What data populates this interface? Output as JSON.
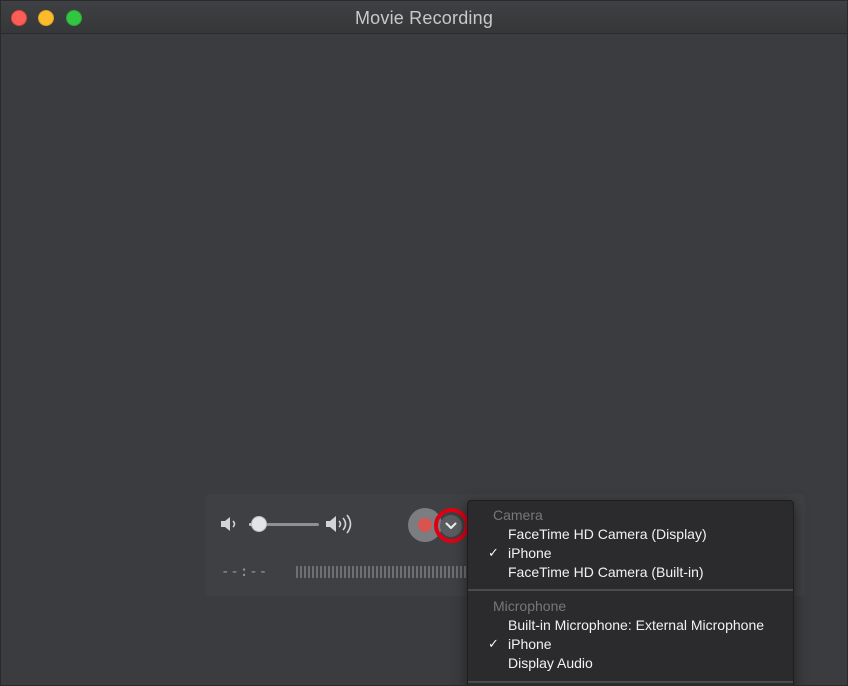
{
  "window": {
    "title": "Movie Recording"
  },
  "controls": {
    "volume_level": 0.05,
    "elapsed_time": "--:--"
  },
  "menu": {
    "camera_header": "Camera",
    "camera_items": [
      {
        "label": "FaceTime HD Camera (Display)",
        "checked": false
      },
      {
        "label": "iPhone",
        "checked": true
      },
      {
        "label": "FaceTime HD Camera (Built-in)",
        "checked": false
      }
    ],
    "microphone_header": "Microphone",
    "microphone_items": [
      {
        "label": "Built-in Microphone: External Microphone",
        "checked": false
      },
      {
        "label": "iPhone",
        "checked": true
      },
      {
        "label": "Display Audio",
        "checked": false
      }
    ],
    "check_glyph": "✓"
  },
  "colors": {
    "highlight_ring": "#e00014",
    "record_dot": "#d9534f"
  },
  "icons": [
    "close-icon",
    "minimize-icon",
    "maximize-icon",
    "speaker-low-icon",
    "speaker-high-icon",
    "record-icon",
    "chevron-down-icon"
  ]
}
